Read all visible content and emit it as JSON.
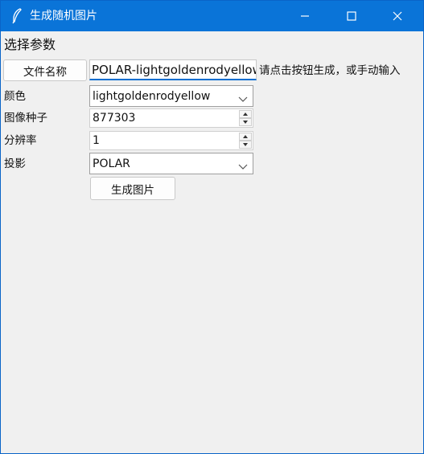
{
  "window": {
    "title": "生成随机图片",
    "app_icon": "feather-icon",
    "minimize_icon": "minimize-icon",
    "maximize_icon": "maximize-icon",
    "close_icon": "close-icon",
    "titlebar_color": "#0a74d8"
  },
  "form": {
    "section_title": "选择参数",
    "filename": {
      "button_label": "文件名称",
      "value": "POLAR-lightgoldenrodyellow",
      "hint": "请点击按钮生成，或手动输入"
    },
    "color": {
      "label": "颜色",
      "value": "lightgoldenrodyellow",
      "icon": "chevron-down-icon"
    },
    "seed": {
      "label": "图像种子",
      "value": "877303"
    },
    "resolution": {
      "label": "分辨率",
      "value": "1"
    },
    "projection": {
      "label": "投影",
      "value": "POLAR",
      "icon": "chevron-down-icon"
    },
    "generate_button_label": "生成图片"
  }
}
